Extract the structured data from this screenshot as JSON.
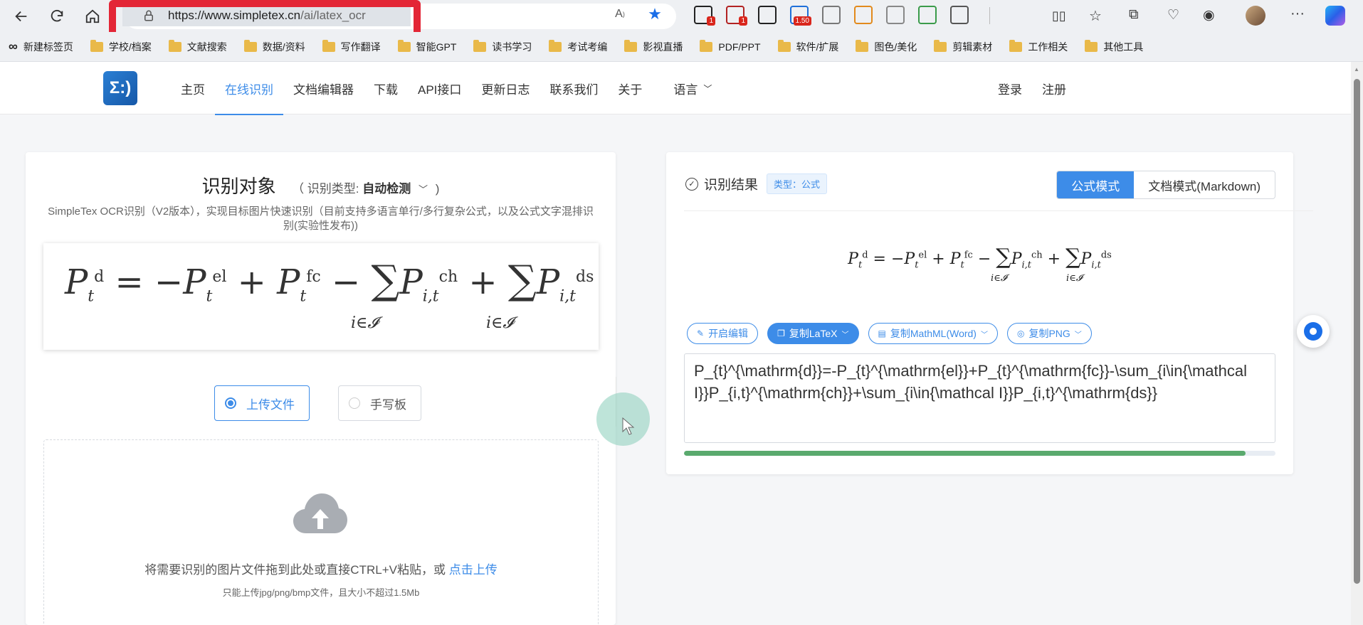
{
  "browser": {
    "url_domain": "https://www.simpletex.cn",
    "url_path": "/ai/latex_ocr",
    "extensions": [
      {
        "name": "ext-badge-icon",
        "badge": "1",
        "color": "#222"
      },
      {
        "name": "shield-ext-icon",
        "badge": "1",
        "color": "#b22222"
      },
      {
        "name": "infinity-icon",
        "badge": "",
        "color": "#222"
      },
      {
        "name": "media-ext-icon",
        "badge": "1.50",
        "color": "#1e6fd9"
      },
      {
        "name": "document-icon",
        "badge": "",
        "color": "#777"
      },
      {
        "name": "palette-icon",
        "badge": "",
        "color": "#e28a1c"
      },
      {
        "name": "swirl-icon",
        "badge": "",
        "color": "#888"
      },
      {
        "name": "printer-icon",
        "badge": "",
        "color": "#3a9b4a"
      },
      {
        "name": "puzzle-icon",
        "badge": "",
        "color": "#555"
      }
    ]
  },
  "bookmarks": [
    "新建标签页",
    "学校/档案",
    "文献搜索",
    "数据/资料",
    "写作翻译",
    "智能GPT",
    "读书学习",
    "考试考编",
    "影视直播",
    "PDF/PPT",
    "软件/扩展",
    "图色/美化",
    "剪辑素材",
    "工作相关",
    "其他工具"
  ],
  "site": {
    "logo_text": "Σ:)",
    "nav": [
      "主页",
      "在线识别",
      "文档编辑器",
      "下载",
      "API接口",
      "更新日志",
      "联系我们",
      "关于"
    ],
    "active_nav_index": 1,
    "lang_label": "语言",
    "login": "登录",
    "register": "注册"
  },
  "left": {
    "title": "识别对象",
    "type_prefix": "（ 识别类型:",
    "type_value": "自动检测",
    "type_suffix": ")",
    "description": "SimpleTex OCR识别（V2版本），实现目标图片快速识别（目前支持多语言单行/多行复杂公式，以及公式文字混排识别(实验性发布))",
    "upload_mode": "上传文件",
    "handwrite_mode": "手写板",
    "drop_text": "将需要识别的图片文件拖到此处或直接CTRL+V粘贴，或",
    "drop_link": "点击上传",
    "drop_hint": "只能上传jpg/png/bmp文件，且大小不超过1.5Mb"
  },
  "right": {
    "title": "识别结果",
    "type_tag": "类型：公式",
    "mode_formula": "公式模式",
    "mode_doc": "文档模式(Markdown)",
    "actions": [
      {
        "label": "开启编辑",
        "icon": "edit-icon",
        "dropdown": false,
        "primary": false
      },
      {
        "label": "复制LaTeX",
        "icon": "copy-icon",
        "dropdown": true,
        "primary": true
      },
      {
        "label": "复制MathML(Word)",
        "icon": "file-icon",
        "dropdown": true,
        "primary": false
      },
      {
        "label": "复制PNG",
        "icon": "image-icon",
        "dropdown": true,
        "primary": false
      }
    ],
    "latex": "P_{t}^{\\mathrm{d}}=-P_{t}^{\\mathrm{el}}+P_{t}^{\\mathrm{fc}}-\\sum_{i\\in{\\mathcal I}}P_{i,t}^{\\mathrm{ch}}+\\sum_{i\\in{\\mathcal I}}P_{i,t}^{\\mathrm{ds}}",
    "progress_percent": 95
  },
  "colors": {
    "accent": "#3d8ce8",
    "progress": "#5aaa6e",
    "highlight_box": "#e32636"
  }
}
